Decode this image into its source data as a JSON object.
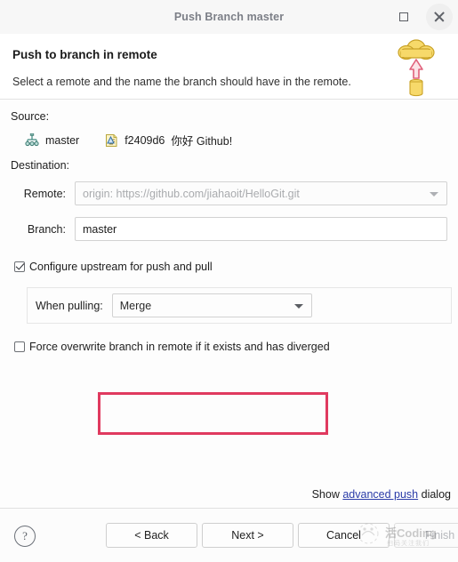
{
  "window": {
    "title": "Push Branch master",
    "maximize_icon": "maximize-icon",
    "close_icon": "close-icon"
  },
  "header": {
    "title": "Push to branch in remote",
    "subtitle": "Select a remote and the name the branch should have in the remote.",
    "graphic_icon": "cloud-upload-icon"
  },
  "source": {
    "label": "Source:",
    "branch_icon": "git-branch-icon",
    "branch_name": "master",
    "commit_icon": "commit-note-icon",
    "commit_hash": "f2409d6",
    "commit_message": "你好 Github!"
  },
  "destination": {
    "label": "Destination:",
    "remote_label": "Remote:",
    "remote_value": "origin: https://github.com/jiahaoit/HelloGit.git",
    "branch_label": "Branch:",
    "branch_value": "master"
  },
  "options": {
    "configure_upstream_label": "Configure upstream for push and pull",
    "configure_upstream_checked": true,
    "when_pulling_label": "When pulling:",
    "when_pulling_value": "Merge",
    "force_overwrite_label": "Force overwrite branch in remote if it exists and has diverged",
    "force_overwrite_checked": false
  },
  "advanced": {
    "prefix": "Show",
    "link": "advanced push",
    "suffix": "dialog"
  },
  "footer": {
    "help_icon": "help-icon",
    "back_label": "< Back",
    "next_label": "Next >",
    "cancel_label": "Cancel",
    "finish_label": "Finish"
  },
  "watermark": {
    "text": "活Coding",
    "sub": "扫码关注我们"
  },
  "colors": {
    "annotation_red": "#e03a5f",
    "link_blue": "#2a3ba8",
    "cloud_yellow": "#f5d76e",
    "arrow_pink": "#e8697f"
  }
}
